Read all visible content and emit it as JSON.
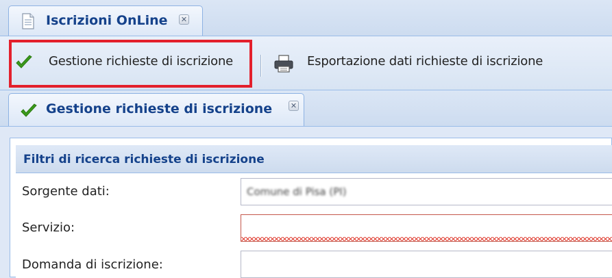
{
  "outer_tab": {
    "label": "Iscrizioni OnLine",
    "icon": "document-icon",
    "close_icon": "close-icon"
  },
  "toolbar": {
    "buttons": [
      {
        "label": "Gestione richieste di iscrizione",
        "icon": "checkmark-icon",
        "highlighted": true
      },
      {
        "label": "Esportazione dati richieste di iscrizione",
        "icon": "printer-icon"
      }
    ]
  },
  "inner_tab": {
    "label": "Gestione richieste di iscrizione",
    "icon": "checkmark-icon",
    "close_icon": "close-icon"
  },
  "filter_panel": {
    "title": "Filtri di ricerca richieste di iscrizione",
    "fields": [
      {
        "label": "Sorgente dati:",
        "value": "Comune di Pisa (PI)",
        "value_obscured": true
      },
      {
        "label": "Servizio:",
        "value": "",
        "invalid": true
      },
      {
        "label": "Domanda di iscrizione:",
        "value": ""
      }
    ]
  },
  "colors": {
    "accent_text": "#15428b",
    "highlight_border": "#e3202c",
    "invalid_underline": "#e04236",
    "check_green": "#3a9a1c"
  }
}
